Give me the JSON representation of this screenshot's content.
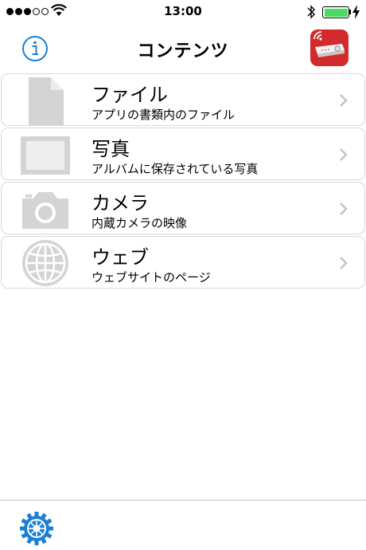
{
  "status_bar": {
    "time": "13:00",
    "signal_icon": "signal-dots-icon",
    "wifi_icon": "wifi-icon",
    "bluetooth_icon": "bluetooth-icon",
    "battery_icon": "battery-icon",
    "battery_level": 1.0,
    "battery_color": "#4cd964"
  },
  "nav": {
    "title": "コンテンツ",
    "left_icon": "info-icon",
    "right_icon": "projector-app-icon",
    "accent_color": "#1a7fd6",
    "app_icon_color": "#d32a2c"
  },
  "list": {
    "items": [
      {
        "title": "ファイル",
        "subtitle": "アプリの書類内のファイル",
        "icon": "document-icon"
      },
      {
        "title": "写真",
        "subtitle": "アルバムに保存されている写真",
        "icon": "photo-frame-icon"
      },
      {
        "title": "カメラ",
        "subtitle": "内蔵カメラの映像",
        "icon": "camera-icon"
      },
      {
        "title": "ウェブ",
        "subtitle": "ウェブサイトのページ",
        "icon": "globe-icon"
      }
    ],
    "icon_color": "#d4d4d4",
    "chevron_icon": "chevron-right-icon"
  },
  "toolbar": {
    "settings_icon": "gear-icon",
    "accent_color": "#1a7fd6"
  }
}
